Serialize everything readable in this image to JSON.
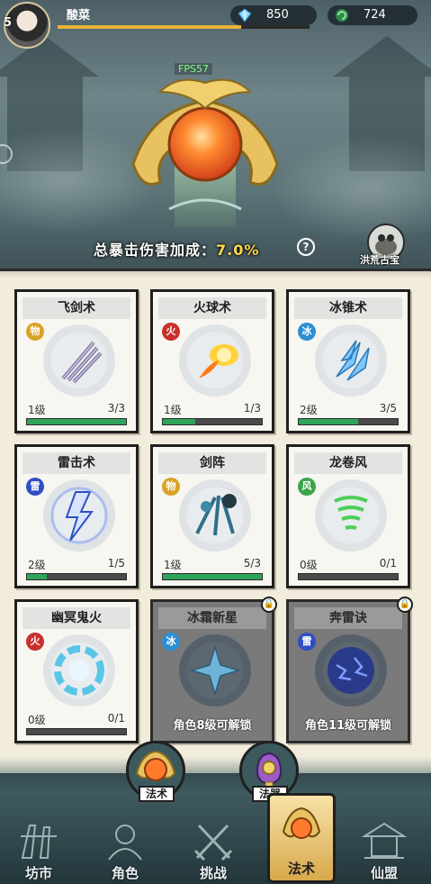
{
  "player": {
    "level": "5",
    "name": "酸菜",
    "xp_fraction": 0.73
  },
  "resources": [
    {
      "icon": "diamond-gem-icon",
      "value": "850"
    },
    {
      "icon": "jade-swirl-icon",
      "value": "724"
    }
  ],
  "fps_label": "FPS57",
  "crit": {
    "label": "总暴击伤害加成：",
    "value": "7.0%",
    "help": "?"
  },
  "treasure_label": "洪荒古宝",
  "colors": {
    "progress_fill": "#2ea35a",
    "accent_gold": "#e8b43a",
    "locked_card": "#7a7a7a"
  },
  "spells": [
    {
      "name": "飞剑术",
      "element": "物",
      "element_color": "#d9a326",
      "level": "1级",
      "count": "3/3",
      "progress": 1.0,
      "icon": "flying-sword-icon",
      "locked": false
    },
    {
      "name": "火球术",
      "element": "火",
      "element_color": "#c9302c",
      "level": "1级",
      "count": "1/3",
      "progress": 0.33,
      "icon": "fireball-icon",
      "locked": false
    },
    {
      "name": "冰锥术",
      "element": "冰",
      "element_color": "#2b8fd6",
      "level": "2级",
      "count": "3/5",
      "progress": 0.6,
      "icon": "ice-cone-icon",
      "locked": false
    },
    {
      "name": "雷击术",
      "element": "雷",
      "element_color": "#2f4fc4",
      "level": "2级",
      "count": "1/5",
      "progress": 0.2,
      "icon": "lightning-icon",
      "locked": false
    },
    {
      "name": "剑阵",
      "element": "物",
      "element_color": "#d9a326",
      "level": "1级",
      "count": "5/3",
      "progress": 1.0,
      "icon": "sword-array-icon",
      "locked": false
    },
    {
      "name": "龙卷风",
      "element": "风",
      "element_color": "#3aa64a",
      "level": "0级",
      "count": "0/1",
      "progress": 0.0,
      "icon": "tornado-icon",
      "locked": false
    },
    {
      "name": "幽冥鬼火",
      "element": "火",
      "element_color": "#c9302c",
      "level": "0级",
      "count": "0/1",
      "progress": 0.0,
      "icon": "ghost-fire-ring-icon",
      "locked": false
    },
    {
      "name": "冰霜新星",
      "element": "冰",
      "element_color": "#2b8fd6",
      "unlock_text": "角色8级可解锁",
      "icon": "frost-nova-icon",
      "locked": true
    },
    {
      "name": "奔雷诀",
      "element": "雷",
      "element_color": "#2f4fc4",
      "unlock_text": "角色11级可解锁",
      "icon": "thunder-orb-icon",
      "locked": true
    }
  ],
  "subtabs": [
    {
      "label": "法术",
      "icon": "spell-orb-icon",
      "active": true
    },
    {
      "label": "法器",
      "icon": "magic-artifact-icon",
      "active": false
    }
  ],
  "nav": [
    {
      "label": "坊市",
      "icon": "market-icon",
      "active": false
    },
    {
      "label": "角色",
      "icon": "character-icon",
      "active": false
    },
    {
      "label": "挑战",
      "icon": "challenge-swords-icon",
      "active": false
    },
    {
      "label": "法术",
      "icon": "spell-icon",
      "active": true
    },
    {
      "label": "仙盟",
      "icon": "alliance-pavilion-icon",
      "active": false
    }
  ]
}
